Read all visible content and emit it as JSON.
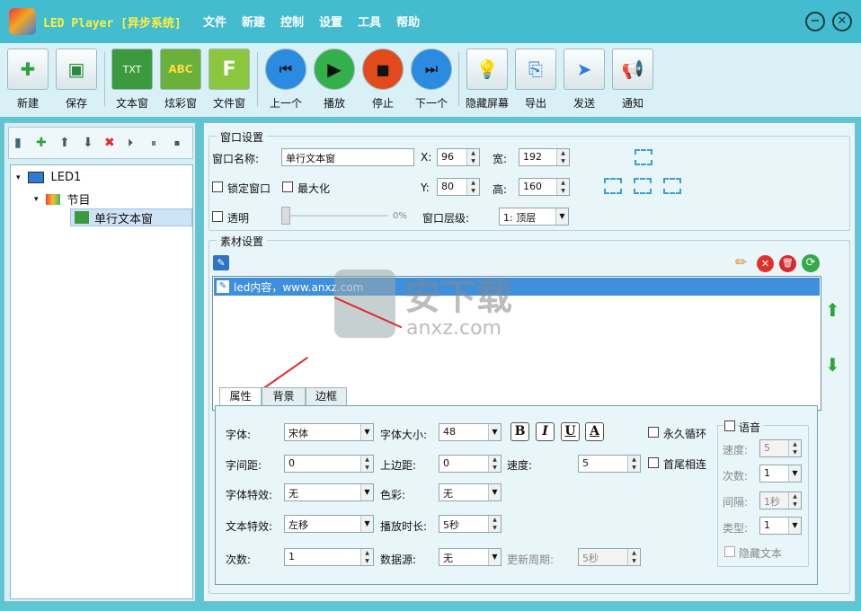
{
  "app": {
    "name": "LED Player [异步系统]",
    "menu": [
      "文件",
      "新建",
      "控制",
      "设置",
      "工具",
      "帮助"
    ]
  },
  "toolbar": [
    "新建",
    "保存",
    "文本窗",
    "炫彩窗",
    "文件窗",
    "上一个",
    "播放",
    "停止",
    "下一个",
    "隐藏屏幕",
    "导出",
    "发送",
    "通知"
  ],
  "tree": {
    "root": "LED1",
    "program": "节目",
    "window": "单行文本窗"
  },
  "window_settings": {
    "title": "窗口设置",
    "name_label": "窗口名称:",
    "name_value": "单行文本窗",
    "x_label": "X:",
    "x_value": "96",
    "w_label": "宽:",
    "w_value": "192",
    "y_label": "Y:",
    "y_value": "80",
    "h_label": "高:",
    "h_value": "160",
    "lock_label": "锁定窗口",
    "max_label": "最大化",
    "transparent_label": "透明",
    "transparent_value": "0%",
    "layer_label": "窗口层级:",
    "layer_value": "1: 顶层"
  },
  "material": {
    "title": "素材设置",
    "item": "led内容，www.anxz.com"
  },
  "tabs": [
    "属性",
    "背景",
    "边框"
  ],
  "props": {
    "font_label": "字体:",
    "font_value": "宋体",
    "size_label": "字体大小:",
    "size_value": "48",
    "spacing_label": "字间距:",
    "spacing_value": "0",
    "top_label": "上边距:",
    "top_value": "0",
    "speed_label": "速度:",
    "speed_value": "5",
    "effect_label": "字体特效:",
    "effect_value": "无",
    "color_label": "色彩:",
    "color_value": "无",
    "text_effect_label": "文本特效:",
    "text_effect_value": "左移",
    "duration_label": "播放时长:",
    "duration_value": "5秒",
    "count_label": "次数:",
    "count_value": "1",
    "source_label": "数据源:",
    "source_value": "无",
    "period_label": "更新周期:",
    "period_value": "5秒",
    "loop_label": "永久循环",
    "head_tail_label": "首尾相连"
  },
  "voice": {
    "title": "语音",
    "speed_label": "速度:",
    "speed_value": "5",
    "count_label": "次数:",
    "count_value": "1",
    "interval_label": "间隔:",
    "interval_value": "1秒",
    "type_label": "类型:",
    "type_value": "1",
    "hide_label": "隐藏文本"
  },
  "watermark": {
    "text": "安下载",
    "sub": "anxz.com"
  }
}
